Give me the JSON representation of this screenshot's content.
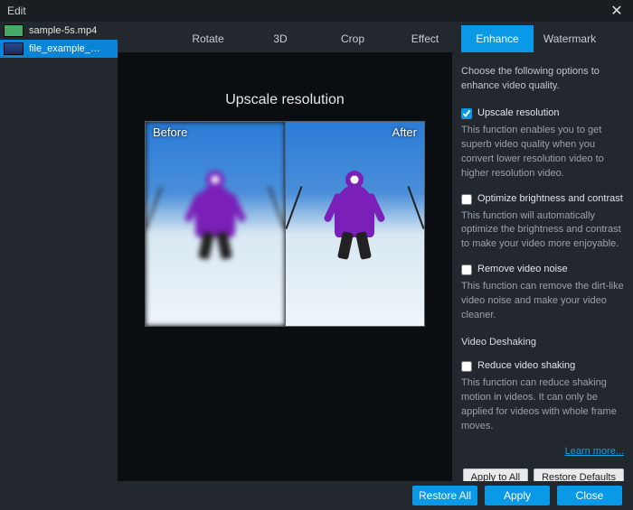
{
  "window": {
    "title": "Edit"
  },
  "sidebar": {
    "items": [
      {
        "name": "sample-5s.mp4",
        "selected": false
      },
      {
        "name": "file_example_…",
        "selected": true
      }
    ]
  },
  "tabs": {
    "items": [
      {
        "label": "Rotate"
      },
      {
        "label": "3D"
      },
      {
        "label": "Crop"
      },
      {
        "label": "Effect"
      },
      {
        "label": "Enhance"
      },
      {
        "label": "Watermark"
      }
    ],
    "active": 4
  },
  "preview": {
    "title": "Upscale resolution",
    "before_label": "Before",
    "after_label": "After"
  },
  "options": {
    "intro": "Choose the following options to enhance video quality.",
    "upscale": {
      "label": "Upscale resolution",
      "checked": true,
      "desc": "This function enables you to get superb video quality when you convert lower resolution video to higher resolution video."
    },
    "brightness": {
      "label": "Optimize brightness and contrast",
      "checked": false,
      "desc": "This function will automatically optimize the brightness and contrast to make your video more enjoyable."
    },
    "noise": {
      "label": "Remove video noise",
      "checked": false,
      "desc": "This function can remove the dirt-like video noise and make your video cleaner."
    },
    "deshake_title": "Video Deshaking",
    "shaking": {
      "label": "Reduce video shaking",
      "checked": false,
      "desc": "This function can reduce shaking motion in videos. It can only be applied for videos with whole frame moves."
    },
    "learn_more": "Learn more..."
  },
  "buttons": {
    "apply_to_all": "Apply to All",
    "restore_defaults": "Restore Defaults",
    "restore_all": "Restore All",
    "apply": "Apply",
    "close": "Close"
  }
}
